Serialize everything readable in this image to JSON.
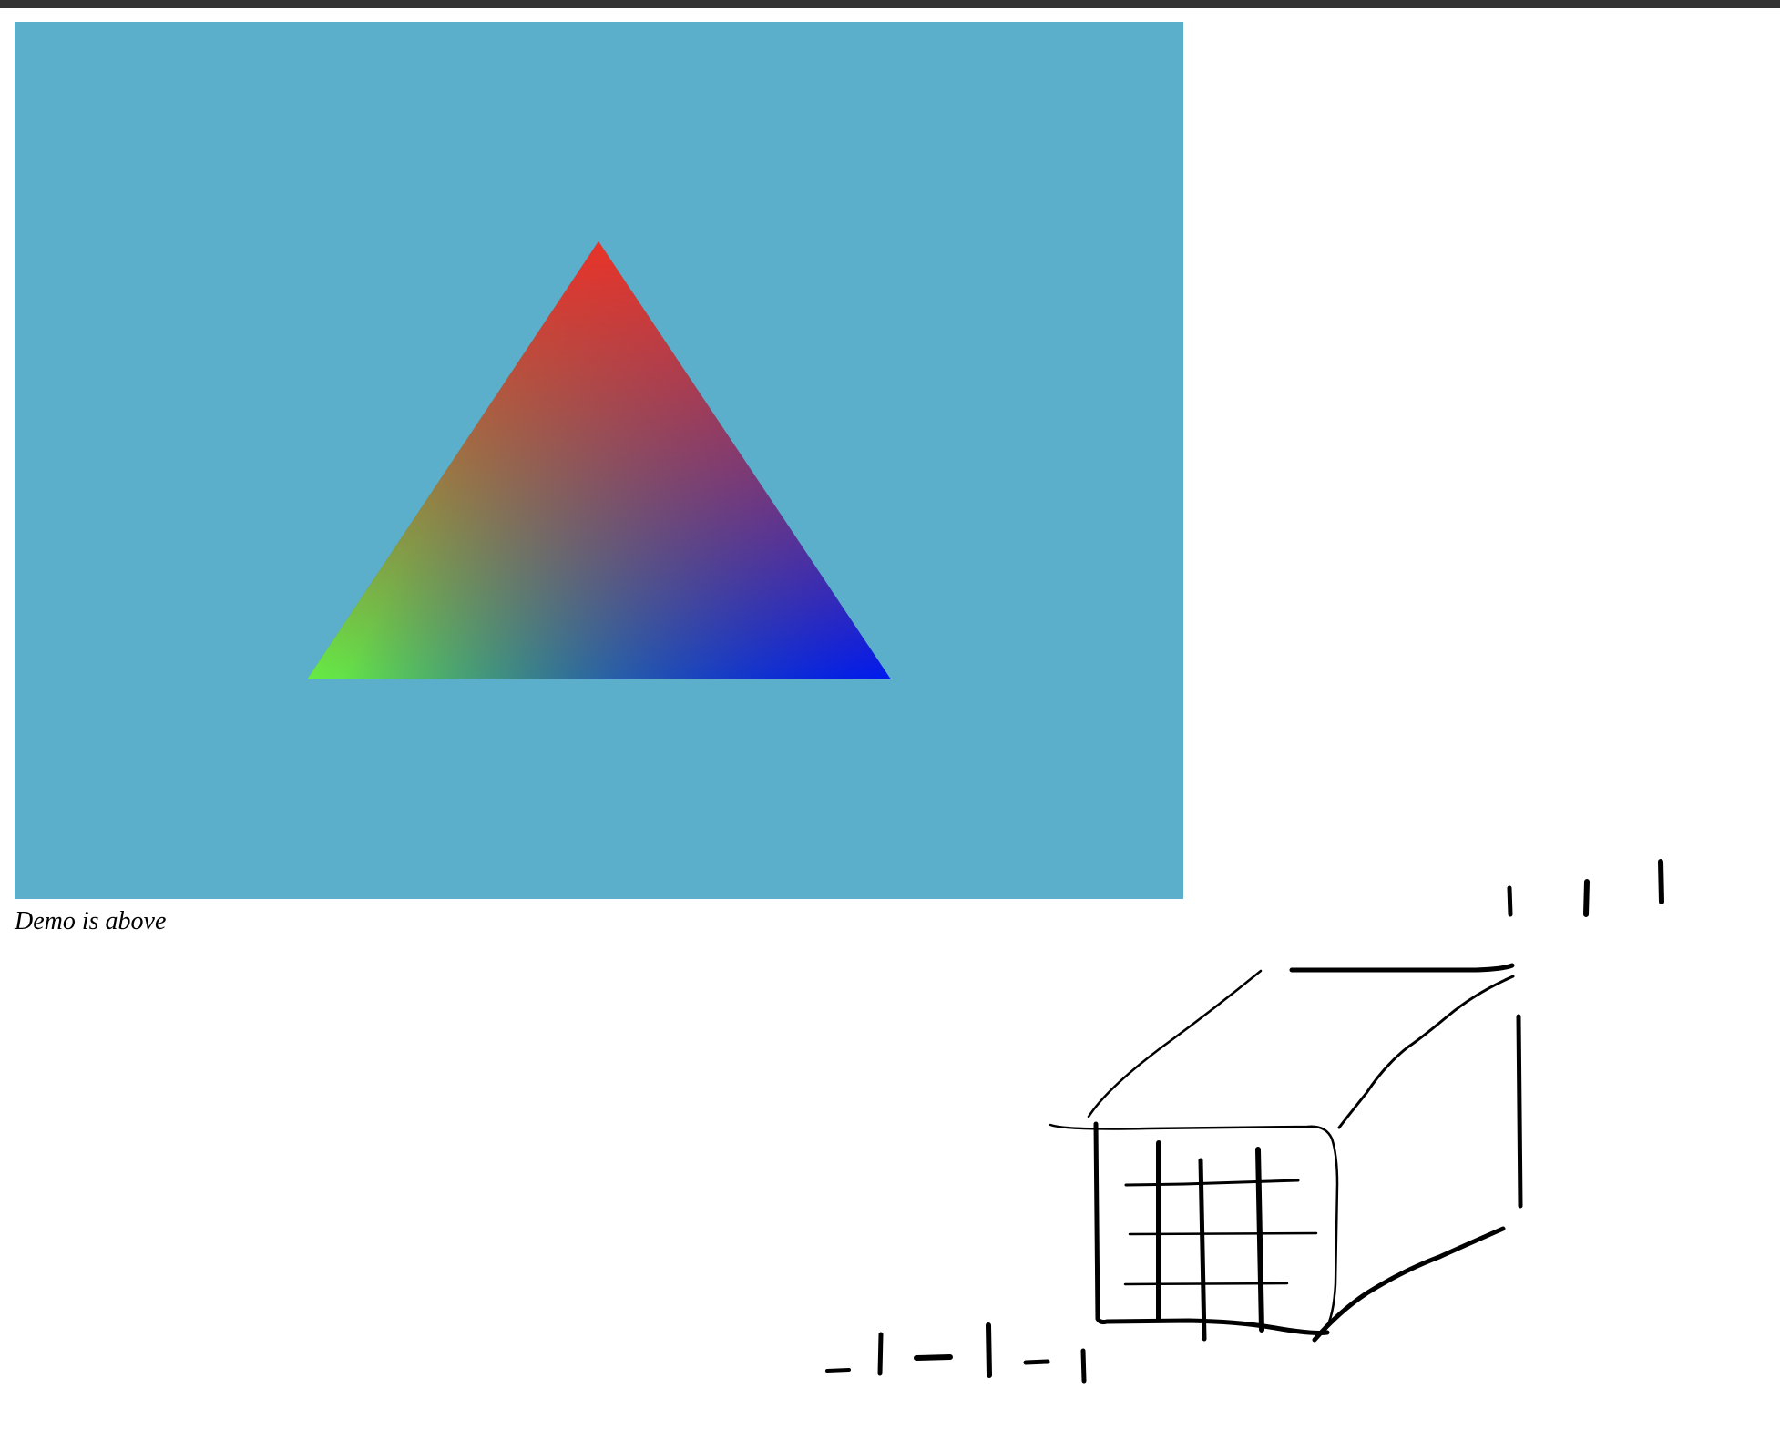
{
  "caption": "Demo is above",
  "canvas": {
    "background": "#5cafca",
    "triangle": {
      "top_color": "#e8332a",
      "left_color": "#66ec44",
      "right_color": "#0019ee"
    }
  },
  "sketch": {
    "stroke": "#000000"
  }
}
